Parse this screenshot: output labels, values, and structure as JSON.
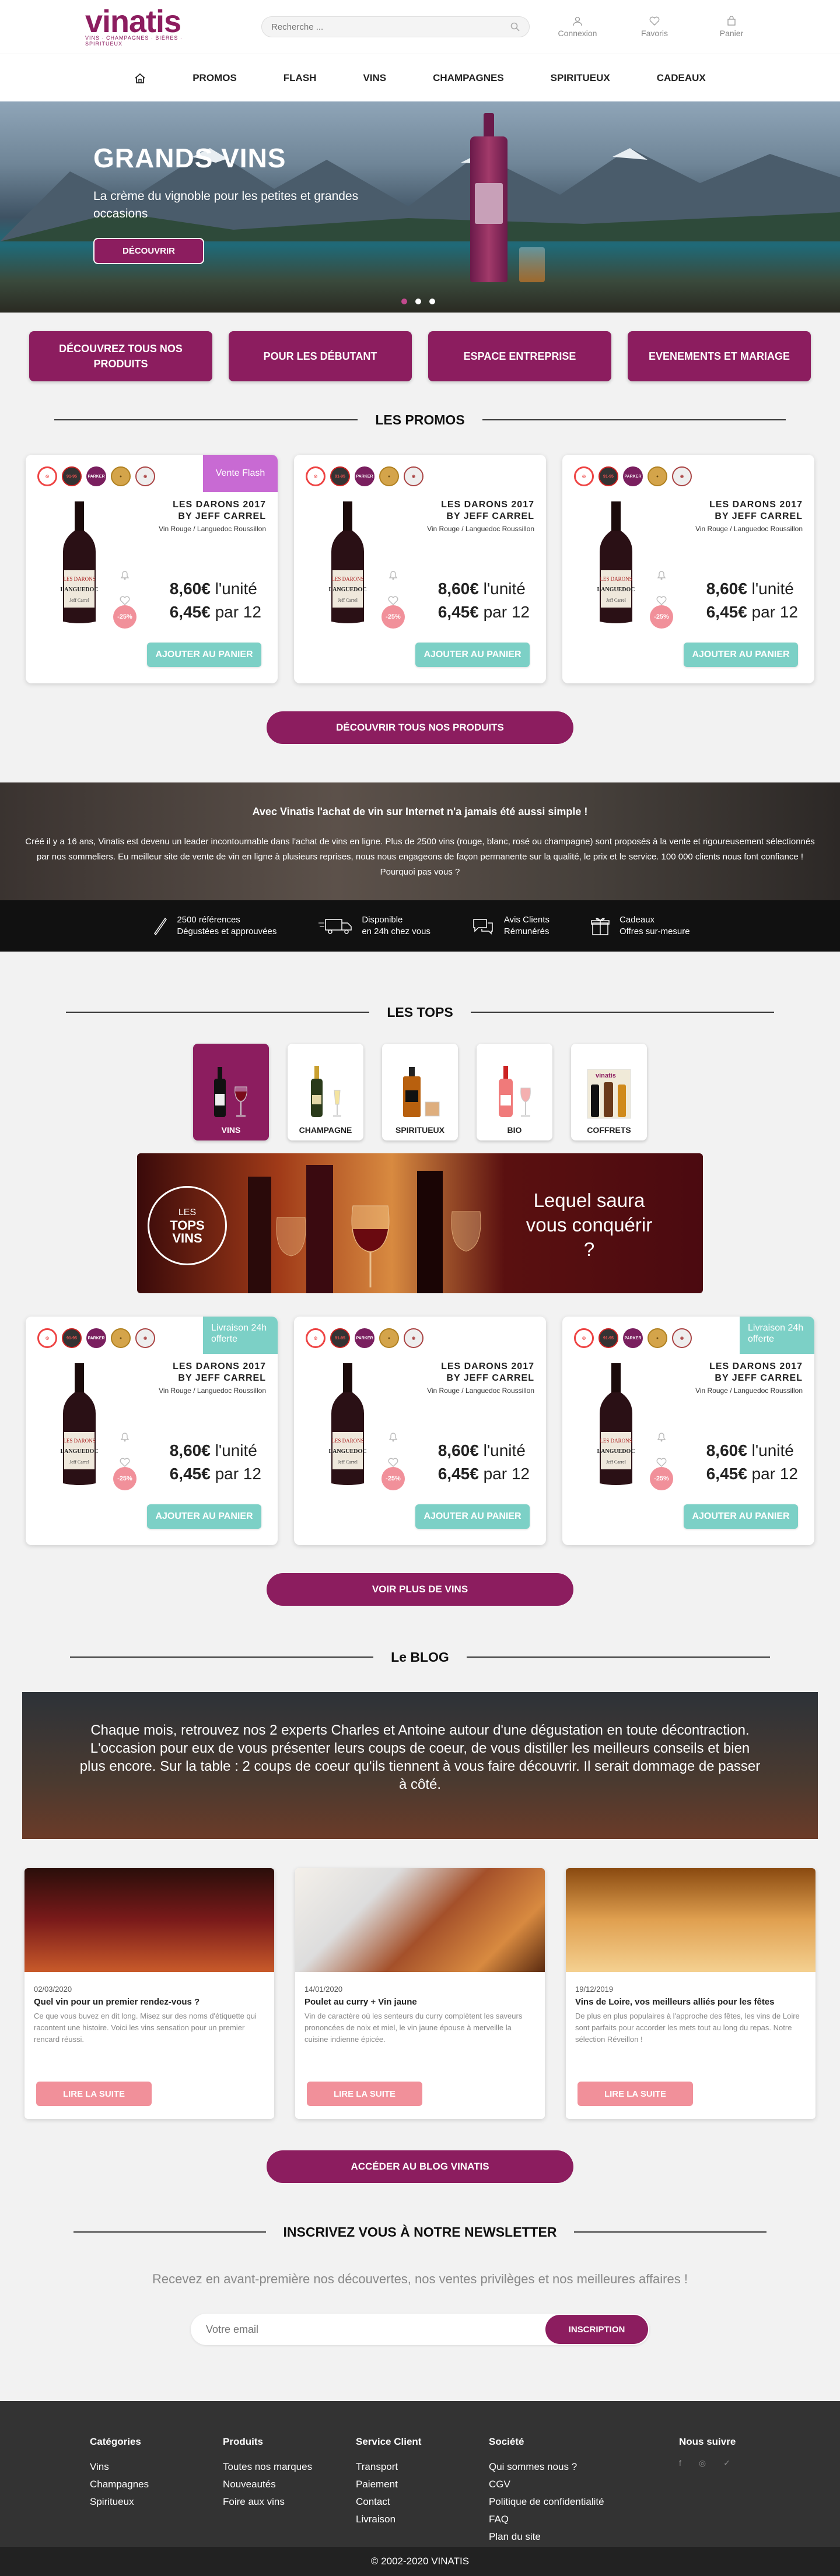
{
  "header": {
    "logo": "vinatis",
    "logo_sub": "VINS · CHAMPAGNES · BIÈRES · SPIRITUEUX",
    "search_placeholder": "Recherche ...",
    "icons": [
      {
        "label": "Connexion"
      },
      {
        "label": "Favoris"
      },
      {
        "label": "Panier"
      }
    ]
  },
  "nav": {
    "items": [
      "PROMOS",
      "FLASH",
      "VINS",
      "CHAMPAGNES",
      "SPIRITUEUX",
      "CADEAUX"
    ]
  },
  "hero": {
    "title": "GRANDS VINS",
    "subtitle": "La crème du vignoble pour les petites et grandes occasions",
    "cta": "DÉCOUVRIR",
    "slide_count": 3,
    "active_slide": 1
  },
  "quick_links": [
    "DÉCOUVREZ TOUS NOS PRODUITS",
    "POUR LES DÉBUTANT",
    "ESPACE ENTREPRISE",
    "EVENEMENTS ET MARIAGE"
  ],
  "promos": {
    "title": "LES PROMOS",
    "products": [
      {
        "name1": "LES DARONS 2017",
        "name2": "BY JEFF CARREL",
        "region": "Vin Rouge / Languedoc Roussillon",
        "badge": "Vente Flash",
        "price_unit": "8,60€",
        "unit_label": "l'unité",
        "discount": "-25%",
        "price_12": "6,45€",
        "price_12_label": "par 12",
        "button": "AJOUTER AU PANIER"
      },
      {
        "name1": "LES DARONS 2017",
        "name2": "BY JEFF CARREL",
        "region": "Vin Rouge / Languedoc Roussillon",
        "badge": "",
        "price_unit": "8,60€",
        "unit_label": "l'unité",
        "discount": "-25%",
        "price_12": "6,45€",
        "price_12_label": "par 12",
        "button": "AJOUTER AU PANIER"
      },
      {
        "name1": "LES DARONS 2017",
        "name2": "BY JEFF CARREL",
        "region": "Vin Rouge / Languedoc Roussillon",
        "badge": "",
        "price_unit": "8,60€",
        "unit_label": "l'unité",
        "discount": "-25%",
        "price_12": "6,45€",
        "price_12_label": "par 12",
        "button": "AJOUTER AU PANIER"
      }
    ],
    "cta": "DÉCOUVRIR TOUS NOS PRODUITS"
  },
  "about": {
    "title": "Avec Vinatis l'achat de vin sur Internet n'a jamais été aussi simple !",
    "text": "Créé il y a 16 ans, Vinatis est devenu un leader incontournable dans l'achat de vins en ligne. Plus de 2500 vins (rouge, blanc, rosé ou champagne) sont proposés à la vente et rigoureusement sélectionnés par nos sommeliers. Eu meilleur site de vente de vin en ligne à plusieurs reprises, nous nous engageons de façon permanente sur la qualité, le prix et le service. 100 000 clients nous font confiance ! Pourquoi pas vous ?",
    "features": [
      {
        "l1": "2500 références",
        "l2": "Dégustées et approuvées"
      },
      {
        "l1": "Disponible",
        "l2": "en 24h chez vous"
      },
      {
        "l1": "Avis Clients",
        "l2": "Rémunérés"
      },
      {
        "l1": "Cadeaux",
        "l2": "Offres sur-mesure"
      }
    ]
  },
  "tops": {
    "title": "LES TOPS",
    "categories": [
      "VINS",
      "CHAMPAGNE",
      "SPIRITUEUX",
      "BIO",
      "COFFRETS"
    ],
    "banner_circle_l1": "LES",
    "banner_circle_l2": "TOPS",
    "banner_circle_l3": "VINS",
    "banner_question": "Lequel saura vous conquérir ?",
    "products": [
      {
        "name1": "LES DARONS 2017",
        "name2": "BY JEFF CARREL",
        "region": "Vin Rouge / Languedoc Roussillon",
        "badge": "Livraison 24h offerte",
        "price_unit": "8,60€",
        "unit_label": "l'unité",
        "discount": "-25%",
        "price_12": "6,45€",
        "price_12_label": "par 12",
        "button": "AJOUTER AU PANIER"
      },
      {
        "name1": "LES DARONS 2017",
        "name2": "BY JEFF CARREL",
        "region": "Vin Rouge / Languedoc Roussillon",
        "badge": "",
        "price_unit": "8,60€",
        "unit_label": "l'unité",
        "discount": "-25%",
        "price_12": "6,45€",
        "price_12_label": "par 12",
        "button": "AJOUTER AU PANIER"
      },
      {
        "name1": "LES DARONS 2017",
        "name2": "BY JEFF CARREL",
        "region": "Vin Rouge / Languedoc Roussillon",
        "badge": "Livraison 24h offerte",
        "price_unit": "8,60€",
        "unit_label": "l'unité",
        "discount": "-25%",
        "price_12": "6,45€",
        "price_12_label": "par 12",
        "button": "AJOUTER AU PANIER"
      }
    ],
    "cta": "VOIR PLUS DE VINS"
  },
  "blog": {
    "title": "Le BLOG",
    "banner_text": "Chaque mois, retrouvez nos 2 experts Charles et Antoine autour d'une dégustation en toute décontraction. L'occasion pour eux de vous présenter leurs coups de coeur, de vous distiller les meilleurs conseils et bien plus encore. Sur la table : 2 coups de coeur qu'ils tiennent à vous faire découvrir. Il serait dommage de passer à côté.",
    "posts": [
      {
        "date": "02/03/2020",
        "title": "Quel vin pour un premier rendez-vous ?",
        "excerpt": "Ce que vous buvez en dit long. Misez sur des noms d'étiquette qui racontent une histoire. Voici les vins sensation pour un premier rencard réussi.",
        "button": "LIRE LA SUITE"
      },
      {
        "date": "14/01/2020",
        "title": "Poulet au curry + Vin jaune",
        "excerpt": "Vin de caractère où les senteurs du curry complètent les saveurs prononcées de noix et miel, le vin jaune épouse à merveille la cuisine indienne épicée.",
        "button": "LIRE LA SUITE"
      },
      {
        "date": "19/12/2019",
        "title": "Vins de Loire, vos meilleurs alliés pour les fêtes",
        "excerpt": "De plus en plus populaires à l'approche des fêtes, les vins de Loire sont parfaits pour accorder les mets tout au long du repas. Notre sélection Réveillon !",
        "button": "LIRE LA SUITE"
      }
    ],
    "cta": "ACCÉDER AU BLOG VINATIS"
  },
  "newsletter": {
    "title": "INSCRIVEZ VOUS À NOTRE NEWSLETTER",
    "subtitle": "Recevez en avant-première nos découvertes, nos ventes privilèges et nos meilleures affaires !",
    "placeholder": "Votre email",
    "button": "INSCRIPTION"
  },
  "footer": {
    "columns": [
      {
        "title": "Catégories",
        "links": [
          "Vins",
          "Champagnes",
          "Spiritueux"
        ]
      },
      {
        "title": "Produits",
        "links": [
          "Toutes nos marques",
          "Nouveautés",
          "Foire aux vins"
        ]
      },
      {
        "title": "Service Client",
        "links": [
          "Transport",
          "Paiement",
          "Contact",
          "Livraison"
        ]
      },
      {
        "title": "Société",
        "links": [
          "Qui sommes nous ?",
          "CGV",
          "Politique de confidentialité",
          "FAQ",
          "Plan du site"
        ]
      },
      {
        "title": "Nous suivre",
        "links": []
      }
    ],
    "copyright": "© 2002-2020 VINATIS"
  },
  "colors": {
    "brand": "#8c1d5f",
    "teal": "#7cd0c6",
    "pink": "#f1909a",
    "flash": "#c86ad3"
  }
}
